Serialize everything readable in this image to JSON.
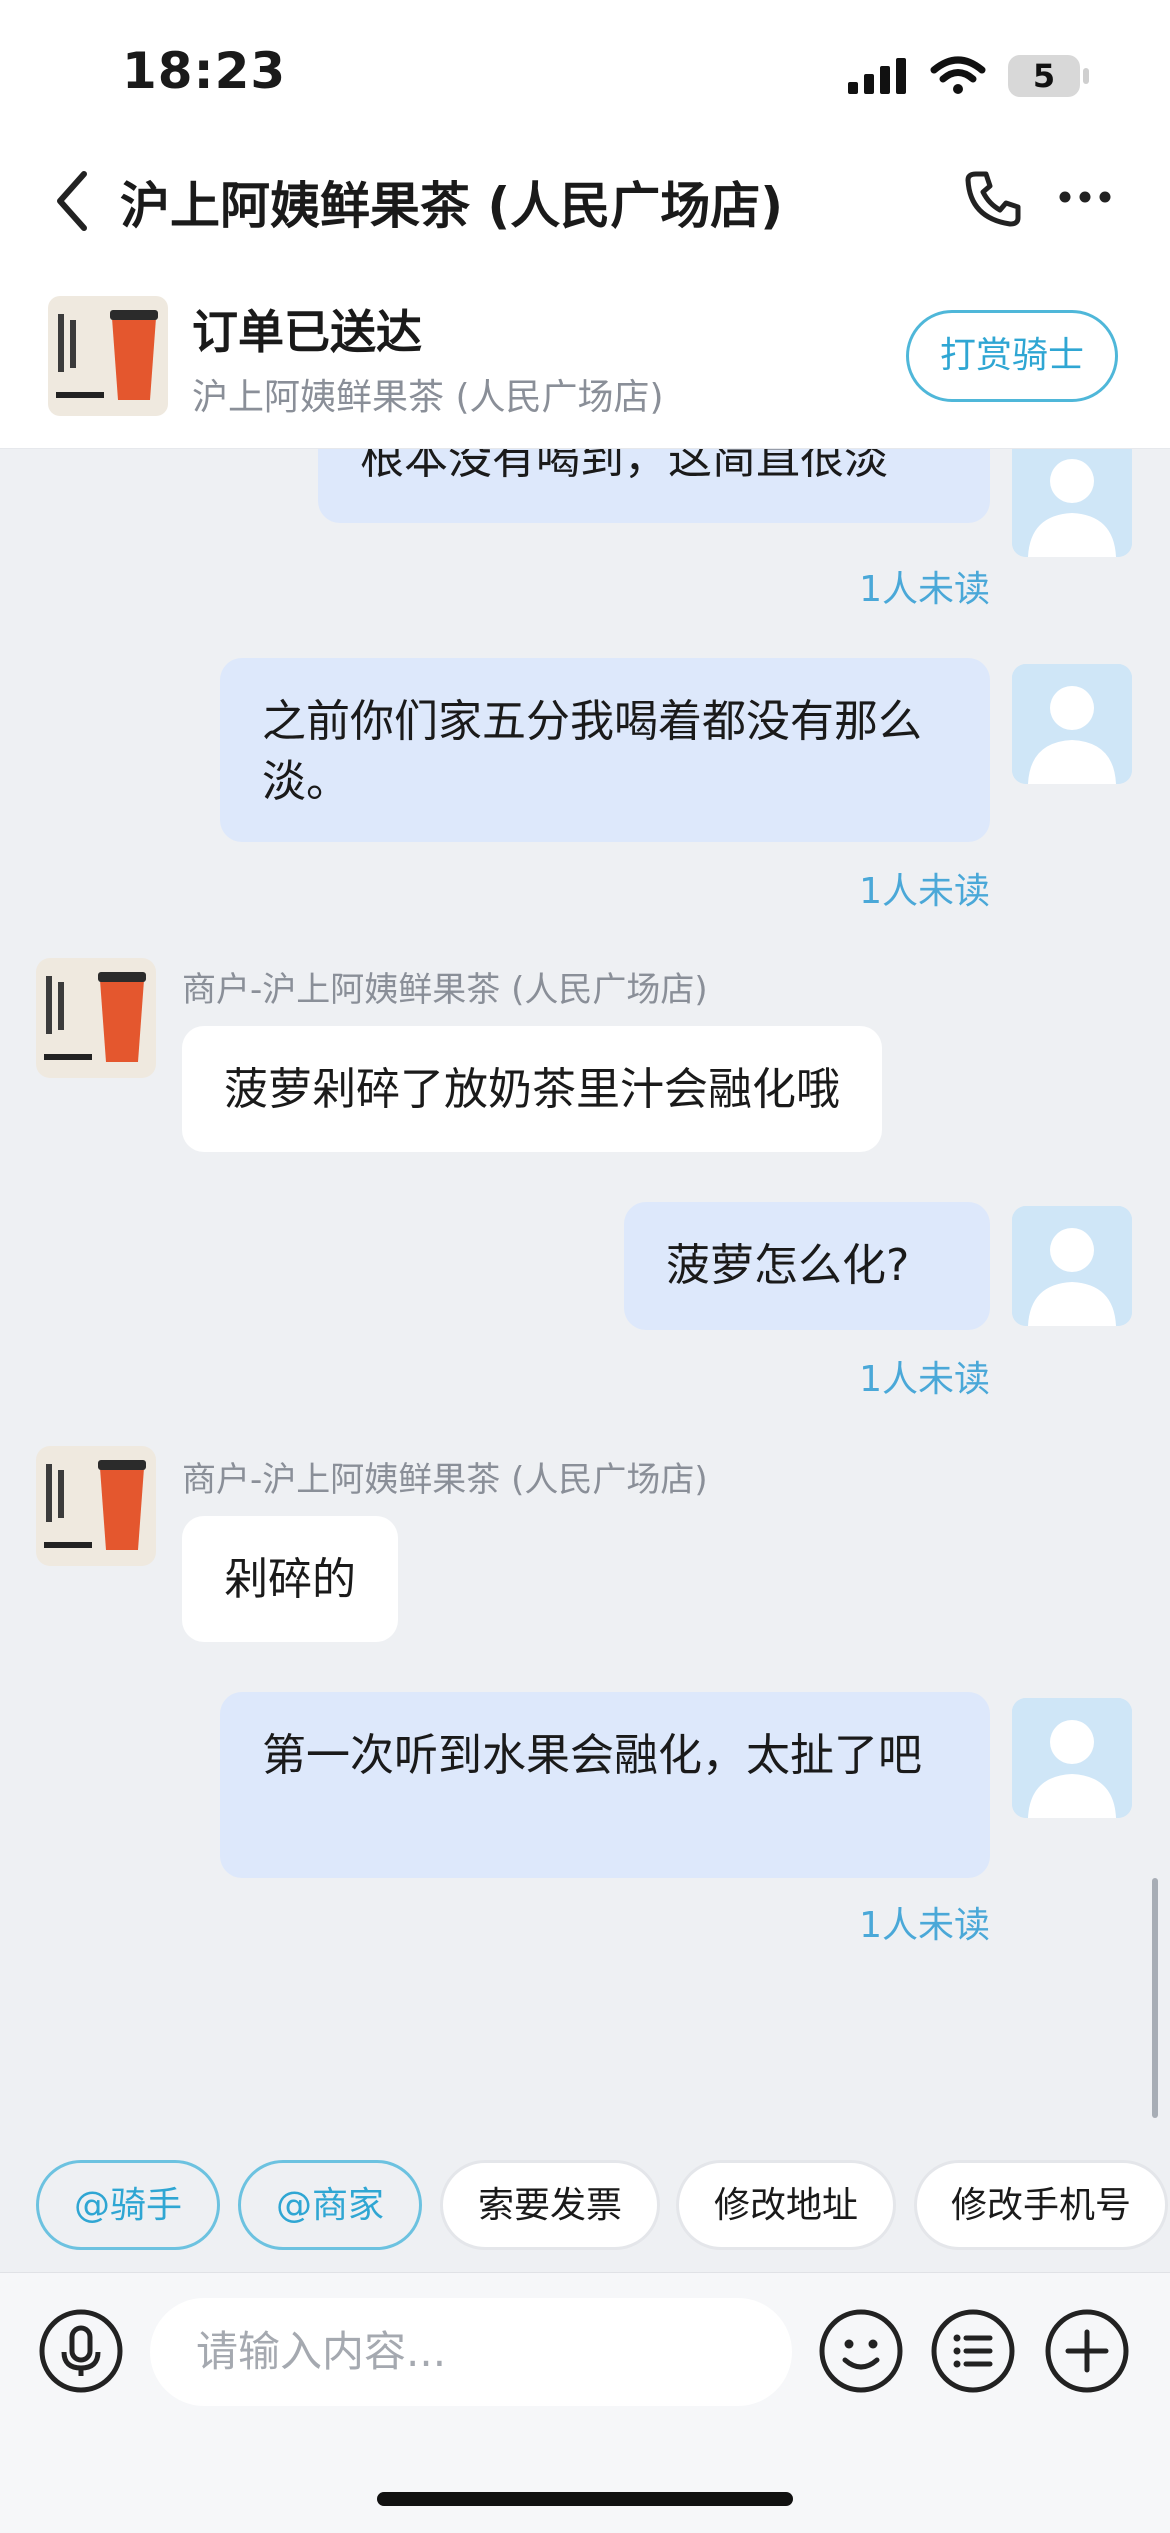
{
  "status_bar": {
    "time": "18:23",
    "battery": "5"
  },
  "header": {
    "title": "沪上阿姨鲜果茶 (人民广场店)"
  },
  "order": {
    "status": "订单已送达",
    "store": "沪上阿姨鲜果茶 (人民广场店)",
    "reward_label": "打赏骑士"
  },
  "messages": [
    {
      "from": "me",
      "text": "根本没有喝到，这简直很淡",
      "read_status": "1人未读"
    },
    {
      "from": "me",
      "text": "之前你们家五分我喝着都没有那么淡。",
      "read_status": "1人未读"
    },
    {
      "from": "merchant",
      "sender": "商户-沪上阿姨鲜果茶 (人民广场店)",
      "text": "菠萝剁碎了放奶茶里汁会融化哦"
    },
    {
      "from": "me",
      "text": "菠萝怎么化?",
      "read_status": "1人未读"
    },
    {
      "from": "merchant",
      "sender": "商户-沪上阿姨鲜果茶 (人民广场店)",
      "text": "剁碎的"
    },
    {
      "from": "me",
      "text": "第一次听到水果会融化，太扯了吧",
      "read_status": "1人未读"
    }
  ],
  "quick_replies": [
    "@骑手",
    "@商家",
    "索要发票",
    "修改地址",
    "修改手机号"
  ],
  "input": {
    "placeholder": "请输入内容..."
  },
  "icons": {
    "back": "chevron-left-icon",
    "phone": "phone-icon",
    "more": "more-icon",
    "voice": "microphone-icon",
    "emoji": "emoji-icon",
    "list": "list-icon",
    "plus": "plus-icon"
  },
  "colors": {
    "accent": "#2fa6d3",
    "my_bubble": "#dde8fb",
    "unread": "#4aa8d8"
  }
}
